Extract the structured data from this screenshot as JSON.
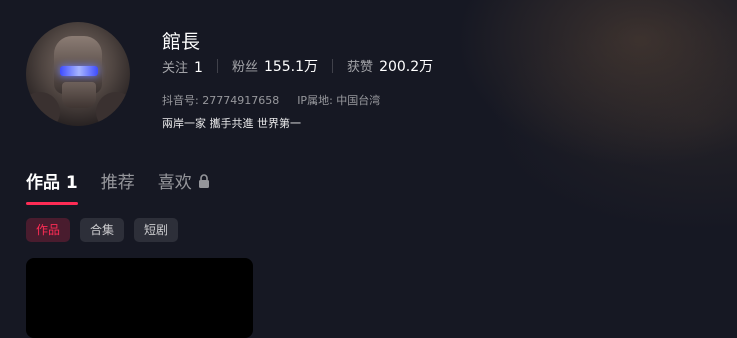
{
  "profile": {
    "name": "館長",
    "stats": [
      {
        "label": "关注",
        "value": "1"
      },
      {
        "label": "粉丝",
        "value": "155.1万"
      },
      {
        "label": "获赞",
        "value": "200.2万"
      }
    ],
    "douyin_id": "抖音号: 27774917658",
    "ip_location": "IP属地: 中国台湾",
    "bio": "兩岸一家 攜手共進 世界第一"
  },
  "tabs": [
    {
      "label": "作品 1"
    },
    {
      "label": "推荐"
    },
    {
      "label": "喜欢",
      "icon": "lock-icon"
    }
  ],
  "chips": [
    {
      "label": "作品"
    },
    {
      "label": "合集"
    },
    {
      "label": "短剧"
    }
  ],
  "colors": {
    "accent": "#fe2c55",
    "background": "#161823"
  }
}
